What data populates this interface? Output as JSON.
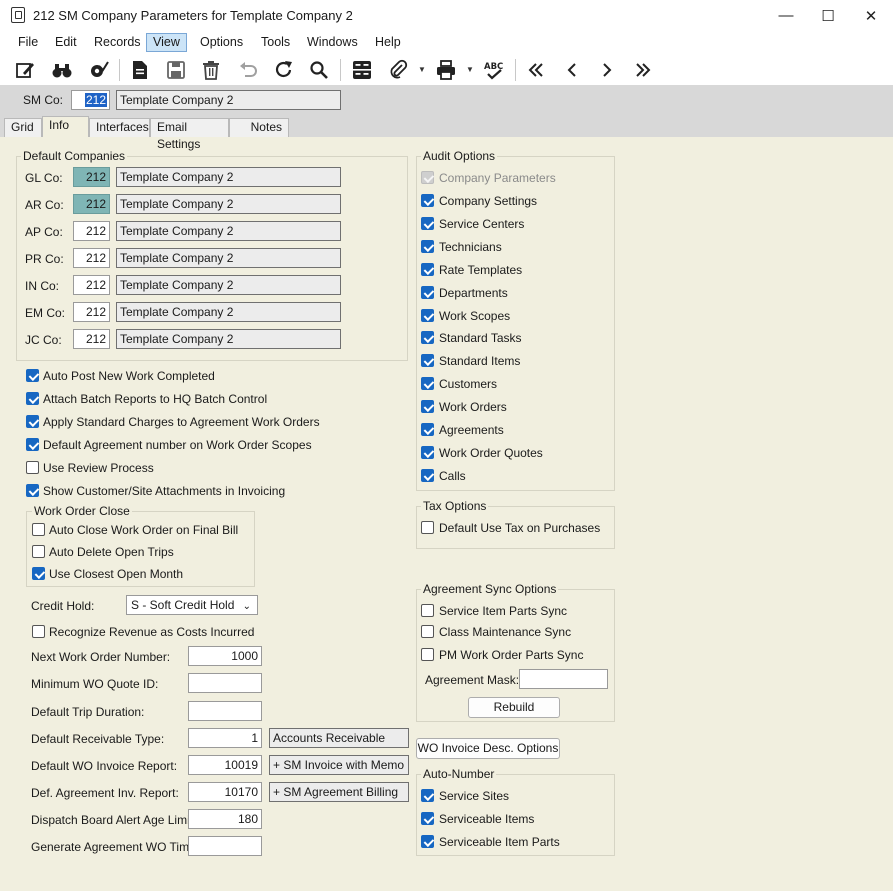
{
  "window": {
    "title": "212 SM Company Parameters for Template Company 2",
    "minimize": "—",
    "maximize": "☐",
    "close": "✕"
  },
  "menu": [
    "File",
    "Edit",
    "Records",
    "View",
    "Options",
    "Tools",
    "Windows",
    "Help"
  ],
  "menu_active": "View",
  "header": {
    "co_label": "SM Co:",
    "co_value": "212",
    "co_name": "Template Company 2"
  },
  "tabs": [
    "Grid",
    "Info",
    "Interfaces",
    "Email Settings",
    "Notes"
  ],
  "active_tab": "Info",
  "default_companies": {
    "title": "Default Companies",
    "rows": [
      {
        "label": "GL Co:",
        "value": "212",
        "name": "Template Company 2"
      },
      {
        "label": "AR Co:",
        "value": "212",
        "name": "Template Company 2"
      },
      {
        "label": "AP Co:",
        "value": "212",
        "name": "Template Company 2"
      },
      {
        "label": "PR Co:",
        "value": "212",
        "name": "Template Company 2"
      },
      {
        "label": "IN Co:",
        "value": "212",
        "name": "Template Company 2"
      },
      {
        "label": "EM Co:",
        "value": "212",
        "name": "Template Company 2"
      },
      {
        "label": "JC Co:",
        "value": "212",
        "name": "Template Company 2"
      }
    ]
  },
  "options": [
    {
      "label": "Auto Post New Work Completed",
      "checked": true
    },
    {
      "label": "Attach Batch Reports to HQ Batch Control",
      "checked": true
    },
    {
      "label": "Apply Standard Charges to Agreement Work Orders",
      "checked": true
    },
    {
      "label": "Default Agreement number on Work Order Scopes",
      "checked": true
    },
    {
      "label": "Use Review Process",
      "checked": false
    },
    {
      "label": "Show Customer/Site Attachments in Invoicing",
      "checked": true
    }
  ],
  "work_order_close": {
    "title": "Work Order Close",
    "items": [
      {
        "label": "Auto Close Work Order on Final Bill",
        "checked": false
      },
      {
        "label": "Auto Delete Open Trips",
        "checked": false
      },
      {
        "label": "Use Closest Open Month",
        "checked": true
      }
    ]
  },
  "credit_hold": {
    "label": "Credit Hold:",
    "value": "S - Soft Credit Hold"
  },
  "recognize_revenue": {
    "label": "Recognize Revenue as Costs Incurred",
    "checked": false
  },
  "fields": [
    {
      "label": "Next Work Order Number:",
      "value": "1000"
    },
    {
      "label": "Minimum WO Quote ID:",
      "value": ""
    },
    {
      "label": "Default Trip Duration:",
      "value": ""
    },
    {
      "label": "Default Receivable Type:",
      "value": "1",
      "desc": "Accounts Receivable"
    },
    {
      "label": "Default WO Invoice Report:",
      "value": "10019",
      "desc": "+ SM Invoice with Memo"
    },
    {
      "label": "Def. Agreement Inv. Report:",
      "value": "10170",
      "desc": "+ SM Agreement Billing"
    },
    {
      "label": "Dispatch Board Alert Age Limit:",
      "value": "180"
    },
    {
      "label": "Generate Agreement WO Time:",
      "value": ""
    }
  ],
  "audit_options": {
    "title": "Audit Options",
    "items": [
      {
        "label": "Company Parameters",
        "checked": true,
        "disabled": true
      },
      {
        "label": "Company Settings",
        "checked": true
      },
      {
        "label": "Service Centers",
        "checked": true
      },
      {
        "label": "Technicians",
        "checked": true
      },
      {
        "label": "Rate Templates",
        "checked": true
      },
      {
        "label": "Departments",
        "checked": true
      },
      {
        "label": "Work Scopes",
        "checked": true
      },
      {
        "label": "Standard Tasks",
        "checked": true
      },
      {
        "label": "Standard Items",
        "checked": true
      },
      {
        "label": "Customers",
        "checked": true
      },
      {
        "label": "Work Orders",
        "checked": true
      },
      {
        "label": "Agreements",
        "checked": true
      },
      {
        "label": "Work Order Quotes",
        "checked": true
      },
      {
        "label": "Calls",
        "checked": true
      }
    ]
  },
  "tax_options": {
    "title": "Tax Options",
    "items": [
      {
        "label": "Default Use Tax on Purchases",
        "checked": false
      }
    ]
  },
  "agreement_sync": {
    "title": "Agreement Sync Options",
    "items": [
      {
        "label": "Service Item Parts Sync",
        "checked": false
      },
      {
        "label": "Class Maintenance Sync",
        "checked": false
      },
      {
        "label": "PM Work Order Parts Sync",
        "checked": false
      }
    ],
    "mask_label": "Agreement Mask:",
    "mask_value": "",
    "rebuild_label": "Rebuild"
  },
  "wo_invoice_desc_label": "WO Invoice Desc. Options",
  "auto_number": {
    "title": "Auto-Number",
    "items": [
      {
        "label": "Service Sites",
        "checked": true
      },
      {
        "label": "Serviceable Items",
        "checked": true
      },
      {
        "label": "Serviceable Item Parts",
        "checked": true
      }
    ]
  }
}
